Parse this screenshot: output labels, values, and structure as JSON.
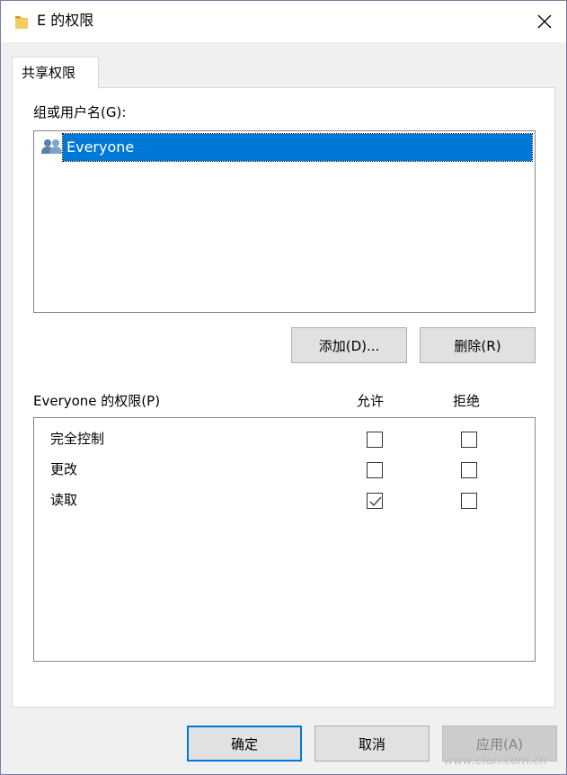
{
  "window": {
    "title": "E 的权限",
    "close_icon": "close-icon"
  },
  "tabs": [
    {
      "label": "共享权限",
      "active": true
    }
  ],
  "groups": {
    "label": "组或用户名(G):",
    "items": [
      {
        "name": "Everyone",
        "icon": "users-icon",
        "selected": true
      }
    ]
  },
  "buttons": {
    "add": "添加(D)...",
    "remove": "删除(R)",
    "ok": "确定",
    "cancel": "取消",
    "apply": "应用(A)"
  },
  "permissions": {
    "label": "Everyone 的权限(P)",
    "allow_header": "允许",
    "deny_header": "拒绝",
    "rows": [
      {
        "name": "完全控制",
        "allow": false,
        "deny": false
      },
      {
        "name": "更改",
        "allow": false,
        "deny": false
      },
      {
        "name": "读取",
        "allow": true,
        "deny": false
      }
    ]
  },
  "watermark": "www.cfan.com.cn",
  "colors": {
    "accent": "#0078d7",
    "border": "#7d7aa8"
  }
}
